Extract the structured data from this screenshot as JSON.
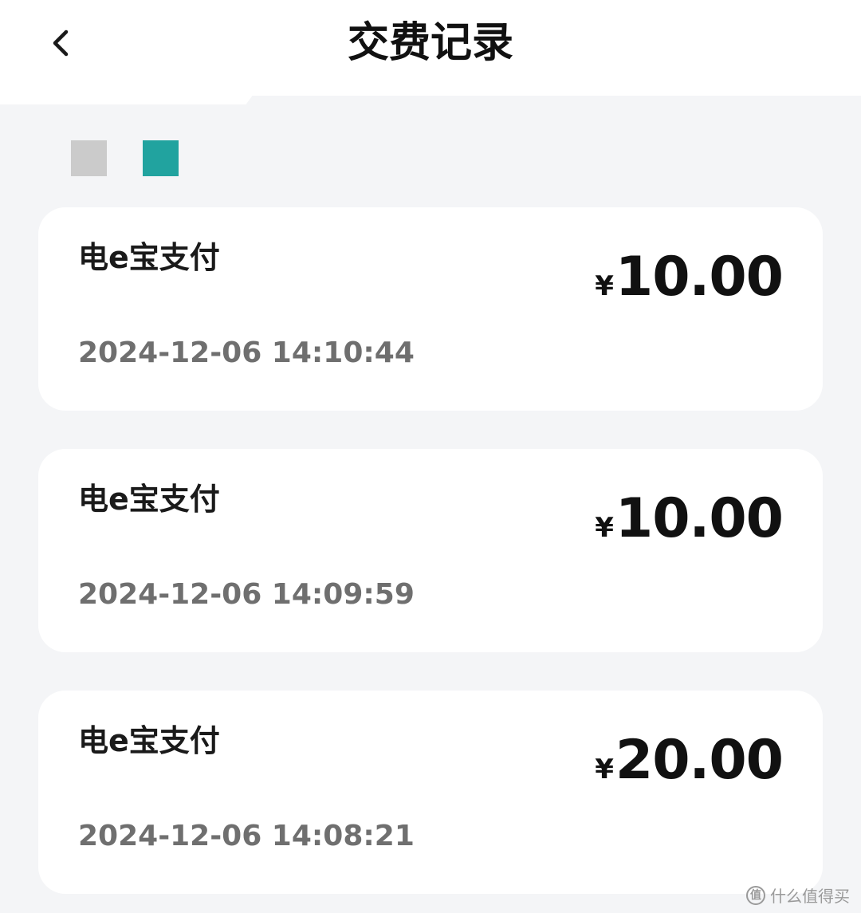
{
  "header": {
    "title": "交费记录",
    "back_icon": "chevron-left-icon"
  },
  "filters": {
    "colors": [
      "#cbcbcb",
      "#21a39f"
    ]
  },
  "records": [
    {
      "method": "电e宝支付",
      "currency": "¥",
      "amount": "10.00",
      "time": "2024-12-06 14:10:44"
    },
    {
      "method": "电e宝支付",
      "currency": "¥",
      "amount": "10.00",
      "time": "2024-12-06 14:09:59"
    },
    {
      "method": "电e宝支付",
      "currency": "¥",
      "amount": "20.00",
      "time": "2024-12-06 14:08:21"
    }
  ],
  "watermark": {
    "icon_text": "值",
    "text": "什么值得买"
  }
}
